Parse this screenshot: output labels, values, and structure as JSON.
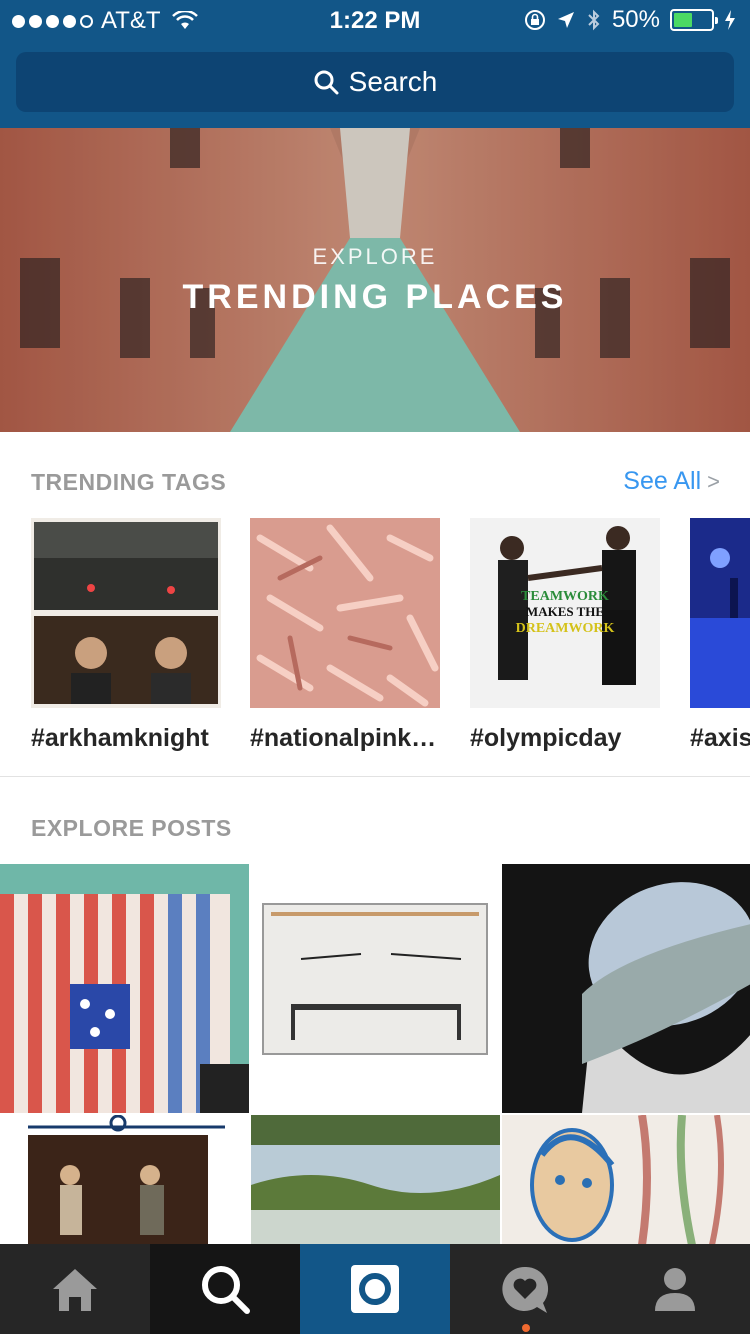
{
  "status_bar": {
    "carrier": "AT&T",
    "time": "1:22 PM",
    "battery": "50%",
    "battery_level": 0.5,
    "icons": [
      "signal-dots-icon",
      "wifi-icon",
      "orientation-lock-icon",
      "location-arrow-icon",
      "bluetooth-icon",
      "battery-icon",
      "charging-bolt-icon"
    ]
  },
  "search": {
    "label": "Search",
    "icon": "search-icon"
  },
  "hero": {
    "subtitle": "EXPLORE",
    "title": "TRENDING PLACES"
  },
  "trending": {
    "title": "TRENDING TAGS",
    "see_all": "See All",
    "tags": [
      {
        "label": "#arkhamknight"
      },
      {
        "label": "#nationalpink…"
      },
      {
        "label": "#olympicday"
      },
      {
        "label": "#axis"
      }
    ],
    "olympic_thumb_text": [
      "TEAMWORK",
      "MAKES THE",
      "DREAMWORK"
    ]
  },
  "explore": {
    "title": "EXPLORE POSTS"
  },
  "tabbar": {
    "tabs": [
      "home-icon",
      "search-icon",
      "camera-icon",
      "activity-heart-icon",
      "profile-icon"
    ],
    "accent_color": "#125688",
    "notification_color": "#f06a30"
  },
  "colors": {
    "header": "#125688",
    "search_bg": "#0d4473",
    "link": "#3897f0"
  }
}
